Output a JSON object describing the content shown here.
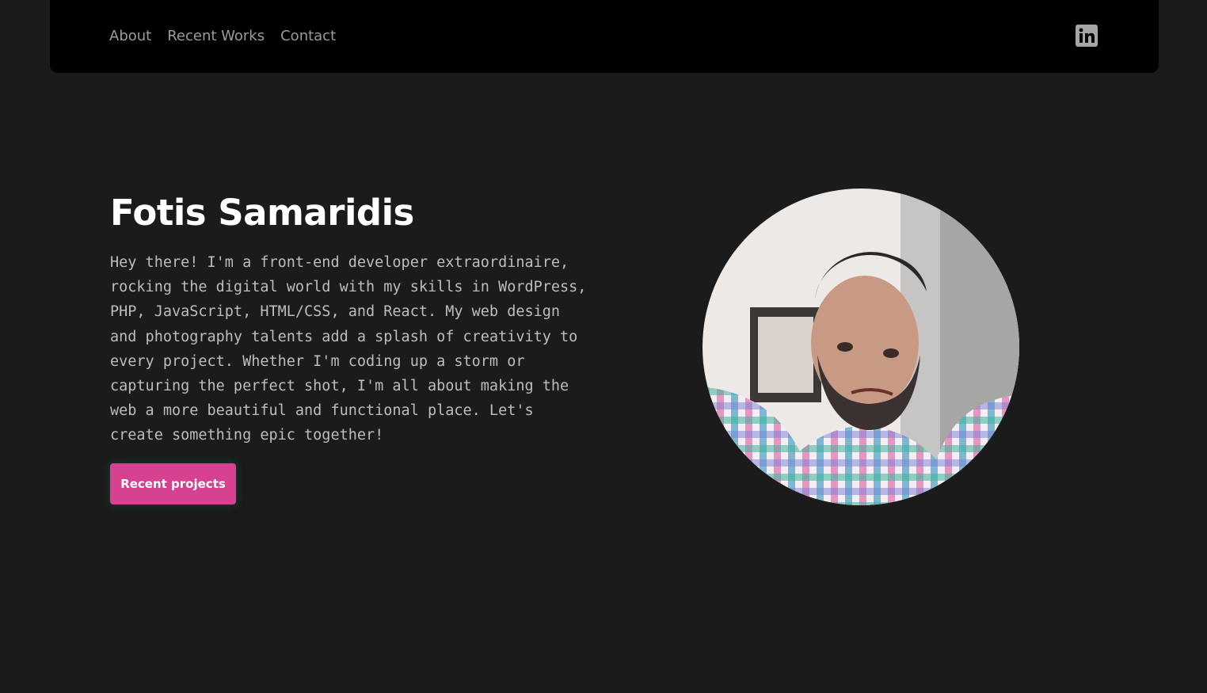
{
  "nav": {
    "links": [
      {
        "label": "About"
      },
      {
        "label": "Recent Works"
      },
      {
        "label": "Contact"
      }
    ],
    "social_icon": "linkedin-icon"
  },
  "hero": {
    "title": "Fotis Samaridis",
    "bio": "Hey there! I'm a front-end developer extraordinaire, rocking the digital world with my skills in WordPress, PHP, JavaScript, HTML/CSS, and React. My web design and photography talents add a splash of creativity to every project. Whether I'm coding up a storm or capturing the perfect shot, I'm all about making the web a more beautiful and functional place. Let's create something epic together!",
    "cta_label": "Recent projects",
    "avatar_alt": "Portrait photo"
  },
  "colors": {
    "background": "#1b1b1b",
    "navbar": "#000000",
    "nav_text": "#9b9b9b",
    "title": "#ffffff",
    "body_text": "#bdbdbd",
    "accent": "#d6428f"
  }
}
